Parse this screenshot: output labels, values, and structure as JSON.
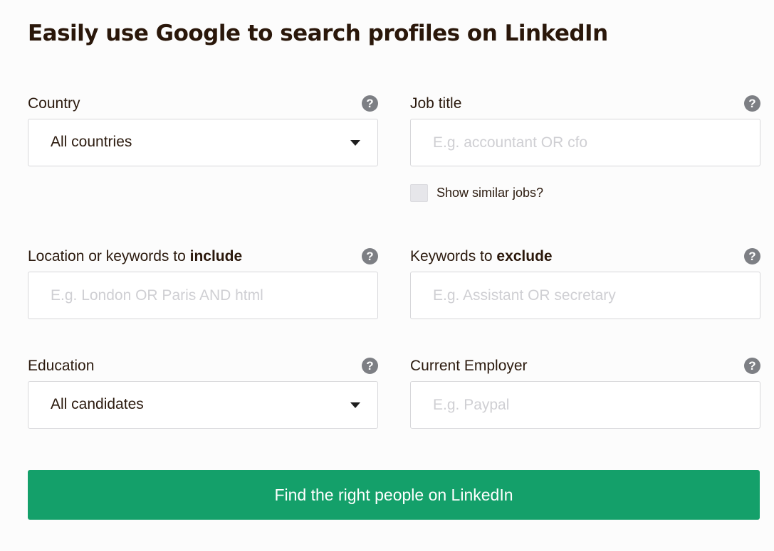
{
  "page": {
    "title": "Easily use Google to search profiles on LinkedIn"
  },
  "help_icon_glyph": "?",
  "fields": {
    "country": {
      "label": "Country",
      "value": "All countries"
    },
    "job_title": {
      "label": "Job title",
      "placeholder": "E.g. accountant OR cfo",
      "similar_jobs_label": "Show similar jobs?"
    },
    "include": {
      "label_prefix": "Location or keywords to ",
      "label_bold": "include",
      "placeholder": "E.g. London OR Paris AND html"
    },
    "exclude": {
      "label_prefix": "Keywords to ",
      "label_bold": "exclude",
      "placeholder": "E.g. Assistant OR secretary"
    },
    "education": {
      "label": "Education",
      "value": "All candidates"
    },
    "employer": {
      "label": "Current Employer",
      "placeholder": "E.g. Paypal"
    }
  },
  "submit": {
    "label": "Find the right people on LinkedIn"
  },
  "colors": {
    "accent": "#14a06a",
    "help_icon": "#7d7f84",
    "text": "#2b1a0e"
  },
  "icons": [
    "question-circle-icon",
    "caret-down-icon"
  ]
}
